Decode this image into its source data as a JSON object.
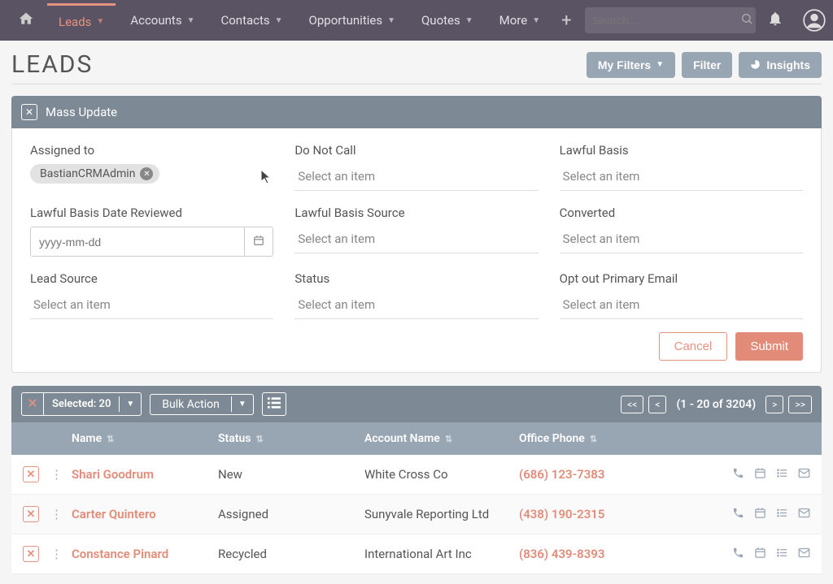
{
  "nav": {
    "items": [
      "Leads",
      "Accounts",
      "Contacts",
      "Opportunities",
      "Quotes",
      "More"
    ],
    "search_placeholder": "Search..."
  },
  "page": {
    "title": "LEADS",
    "actions": {
      "my_filters": "My Filters",
      "filter": "Filter",
      "insights": "Insights"
    }
  },
  "massupdate": {
    "title": "Mass Update",
    "fields": {
      "assigned_label": "Assigned to",
      "assigned_chip": "BastianCRMAdmin",
      "dnc_label": "Do Not Call",
      "lawful_label": "Lawful Basis",
      "date_label": "Lawful Basis Date Reviewed",
      "date_placeholder": "yyyy-mm-dd",
      "source_label": "Lawful Basis Source",
      "converted_label": "Converted",
      "leadsource_label": "Lead Source",
      "status_label": "Status",
      "optout_label": "Opt out Primary Email",
      "select_placeholder": "Select an item"
    },
    "cancel": "Cancel",
    "submit": "Submit"
  },
  "list": {
    "selected": "Selected: 20",
    "bulk": "Bulk Action",
    "pageinfo": "(1 - 20 of 3204)",
    "columns": {
      "name": "Name",
      "status": "Status",
      "account": "Account Name",
      "phone": "Office Phone"
    },
    "rows": [
      {
        "name": "Shari Goodrum",
        "status": "New",
        "account": "White Cross Co",
        "phone": "(686) 123-7383"
      },
      {
        "name": "Carter Quintero",
        "status": "Assigned",
        "account": "Sunyvale Reporting Ltd",
        "phone": "(438) 190-2315"
      },
      {
        "name": "Constance Pinard",
        "status": "Recycled",
        "account": "International Art Inc",
        "phone": "(836) 439-8393"
      }
    ]
  }
}
